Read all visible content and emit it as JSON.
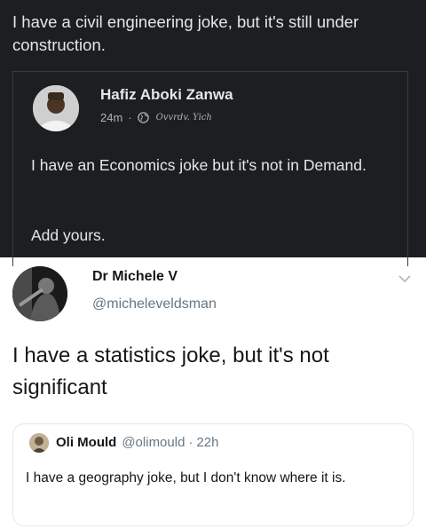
{
  "facebook": {
    "post_text": "I have a civil engineering joke, but it's still under construction.",
    "shared": {
      "author": "Hafiz Aboki Zanwa",
      "time": "24m",
      "separator": "·",
      "privacy_icon": "globe-icon",
      "text": "I have an Economics joke but it's not in Demand.",
      "add_yours": "Add yours."
    },
    "colors": {
      "background": "#1c1e21",
      "text": "#e4e6eb",
      "muted": "#b0b3b8"
    }
  },
  "tweet": {
    "name": "Dr Michele V",
    "handle": "@micheleveldsman",
    "menu_icon": "chevron-down-icon",
    "text": "I have a statistics joke, but it's not significant",
    "quote": {
      "name": "Oli Mould",
      "handle": "@olimould",
      "separator": "·",
      "time": "22h",
      "text": "I have a geography joke, but I don't know where it is."
    },
    "colors": {
      "text": "#14171a",
      "muted": "#657786",
      "border": "#e1e8ed"
    }
  }
}
